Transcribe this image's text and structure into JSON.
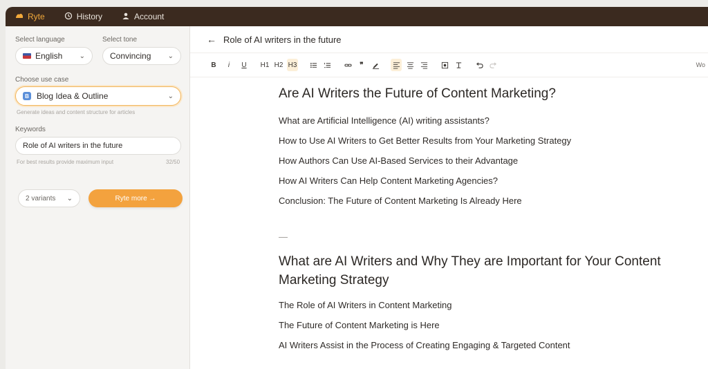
{
  "topnav": {
    "ryte": "Ryte",
    "history": "History",
    "account": "Account"
  },
  "sidebar": {
    "language_label": "Select language",
    "language_value": "English",
    "tone_label": "Select tone",
    "tone_value": "Convincing",
    "usecase_label": "Choose use case",
    "usecase_value": "Blog Idea & Outline",
    "usecase_hint": "Generate ideas and content structure for articles",
    "keywords_label": "Keywords",
    "keywords_value": "Role of AI writers in the future",
    "keywords_hint": "For best results provide maximum input",
    "keywords_count": "32/50",
    "variants_value": "2 variants",
    "ryte_more": "Ryte more →"
  },
  "document": {
    "title": "Role of AI writers in the future",
    "back_icon": "arrow-left-icon",
    "toolbar": [
      "B",
      "i",
      "U",
      "H1",
      "H2",
      "H3"
    ],
    "word_count_label": "Wo",
    "heading1": "Are AI Writers the Future of Content Marketing?",
    "subheadings1": [
      "What are Artificial Intelligence (AI) writing assistants?",
      "How to Use AI Writers to Get Better Results from Your Marketing Strategy",
      "How Authors Can Use AI-Based Services to their Advantage",
      "How AI Writers Can Help Content Marketing Agencies?",
      "Conclusion: The Future of Content Marketing Is Already Here"
    ],
    "divider": "—",
    "heading2": "What are AI Writers and Why They are Important for Your Content Marketing Strategy",
    "subheadings2": [
      "The Role of AI Writers in Content Marketing",
      "The Future of Content Marketing is Here",
      "AI Writers Assist in the Process of Creating Engaging & Targeted Content"
    ]
  },
  "colors": {
    "accent": "#f3a23e",
    "topbar": "#3b2a1f"
  }
}
